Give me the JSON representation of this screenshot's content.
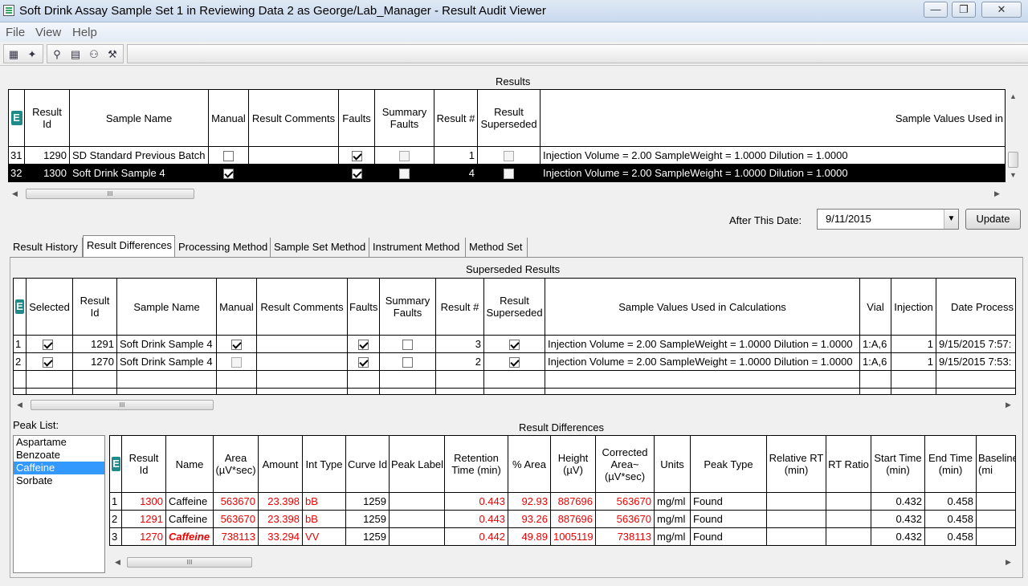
{
  "window": {
    "title": "Soft Drink Assay Sample Set 1 in Reviewing Data 2 as George/Lab_Manager - Result Audit Viewer",
    "min_icon": "minimize-icon",
    "max_icon": "maximize-icon",
    "close_icon": "close-icon",
    "min_glyph": "—",
    "max_glyph": "❐",
    "close_glyph": "✕"
  },
  "menu": {
    "file": "File",
    "view": "View",
    "help": "Help"
  },
  "results": {
    "title": "Results",
    "headers": [
      "Result Id",
      "Sample Name",
      "Manual",
      "Result Comments",
      "Faults",
      "Summary Faults",
      "Result #",
      "Result Superseded",
      "Sample Values Used in"
    ],
    "rows": [
      {
        "row_num": "31",
        "result_id": "1290",
        "sample_name": "SD Standard Previous Batch",
        "manual": false,
        "comments": "",
        "faults": true,
        "summary_faults": false,
        "result_num": "1",
        "superseded": false,
        "values": "Injection Volume = 2.00 SampleWeight = 1.0000 Dilution = 1.0000"
      },
      {
        "row_num": "32",
        "result_id": "1300",
        "sample_name": "Soft Drink Sample 4",
        "manual": true,
        "comments": "",
        "faults": true,
        "summary_faults": false,
        "result_num": "4",
        "superseded": false,
        "values": "Injection Volume = 2.00 SampleWeight = 1.0000 Dilution = 1.0000",
        "selected": true
      }
    ]
  },
  "filter": {
    "after_date_label": "After This Date:",
    "date_value": "9/11/2015",
    "update_label": "Update"
  },
  "tabs": [
    "Result History",
    "Result Differences",
    "Processing Method",
    "Sample Set Method",
    "Instrument Method",
    "Method Set"
  ],
  "active_tab": "Result Differences",
  "superseded": {
    "title": "Superseded Results",
    "headers": [
      "Selected",
      "Result Id",
      "Sample Name",
      "Manual",
      "Result Comments",
      "Faults",
      "Summary Faults",
      "Result #",
      "Result Superseded",
      "Sample Values Used in Calculations",
      "Vial",
      "Injection",
      "Date Process"
    ],
    "rows": [
      {
        "row_num": "1",
        "selected": true,
        "result_id": "1291",
        "sample_name": "Soft Drink Sample 4",
        "manual": true,
        "comments": "",
        "faults": true,
        "summary_faults": false,
        "result_num": "3",
        "superseded": true,
        "values": "Injection Volume = 2.00 SampleWeight = 1.0000 Dilution = 1.0000",
        "vial": "1:A,6",
        "injection": "1",
        "date": "9/15/2015 7:57:"
      },
      {
        "row_num": "2",
        "selected": true,
        "result_id": "1270",
        "sample_name": "Soft Drink Sample 4",
        "manual": false,
        "comments": "",
        "faults": true,
        "summary_faults": false,
        "result_num": "2",
        "superseded": true,
        "values": "Injection Volume = 2.00 SampleWeight = 1.0000 Dilution = 1.0000",
        "vial": "1:A,6",
        "injection": "1",
        "date": "9/15/2015 7:53:"
      }
    ]
  },
  "peak_list": {
    "label": "Peak List:",
    "items": [
      "Aspartame",
      "Benzoate",
      "Caffeine",
      "Sorbate"
    ],
    "selected": "Caffeine"
  },
  "differences": {
    "title": "Result Differences",
    "headers": [
      "Result Id",
      "Name",
      "Area (µV*sec)",
      "Amount",
      "Int Type",
      "Curve Id",
      "Peak Label",
      "Retention Time (min)",
      "% Area",
      "Height (µV)",
      "Corrected Area~ (µV*sec)",
      "Units",
      "Peak Type",
      "Relative RT (min)",
      "RT Ratio",
      "Start Time (min)",
      "End Time (min)",
      "Baseline (mi"
    ],
    "rows": [
      {
        "row_num": "1",
        "result_id": "1300",
        "name": "Caffeine",
        "area": "563670",
        "amount": "23.398",
        "int_type": "bB",
        "curve_id": "1259",
        "peak_label": "",
        "rt": "0.443",
        "pct_area": "92.93",
        "height": "887696",
        "corr_area": "563670",
        "units": "mg/ml",
        "peak_type": "Found",
        "rel_rt": "",
        "rt_ratio": "",
        "start": "0.432",
        "end": "0.458",
        "baseline": ""
      },
      {
        "row_num": "2",
        "result_id": "1291",
        "name": "Caffeine",
        "area": "563670",
        "amount": "23.398",
        "int_type": "bB",
        "curve_id": "1259",
        "peak_label": "",
        "rt": "0.443",
        "pct_area": "93.26",
        "height": "887696",
        "corr_area": "563670",
        "units": "mg/ml",
        "peak_type": "Found",
        "rel_rt": "",
        "rt_ratio": "",
        "start": "0.432",
        "end": "0.458",
        "baseline": ""
      },
      {
        "row_num": "3",
        "result_id": "1270",
        "name": "Caffeine",
        "area": "738113",
        "amount": "33.294",
        "int_type": "VV",
        "curve_id": "1259",
        "peak_label": "",
        "rt": "0.442",
        "pct_area": "49.89",
        "height": "1005119",
        "corr_area": "738113",
        "units": "mg/ml",
        "peak_type": "Found",
        "rel_rt": "",
        "rt_ratio": "",
        "start": "0.432",
        "end": "0.458",
        "baseline": ""
      }
    ]
  },
  "scroll_glyphs": {
    "left": "◀",
    "right": "▶",
    "up": "▲",
    "down": "▼",
    "grip": "III"
  }
}
